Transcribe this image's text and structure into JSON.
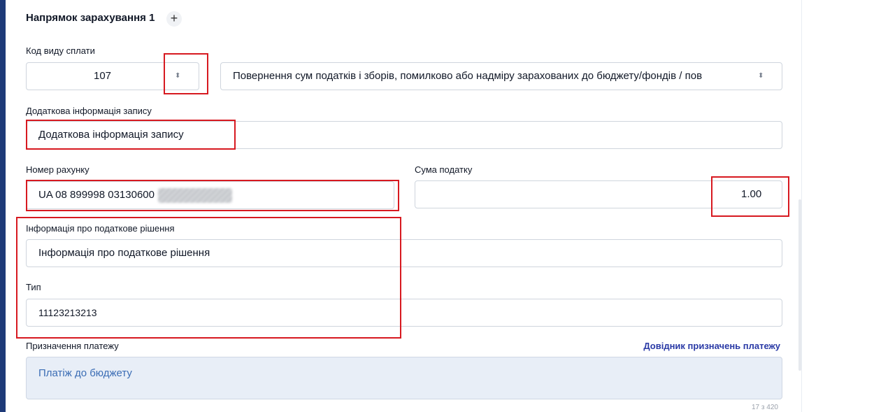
{
  "section": {
    "title": "Напрямок зарахування 1",
    "add_label": "+"
  },
  "payment_code": {
    "label": "Код виду сплати",
    "code_value": "107",
    "description_value": "Повернення сум податків і зборів, помилково або надміру зарахованих до бюджету/фондів / пов"
  },
  "additional_info": {
    "label": "Додаткова інформація запису",
    "value": "Додаткова інформація запису"
  },
  "account": {
    "label": "Номер рахунку",
    "value": "UA 08 899998 03130600"
  },
  "tax_amount": {
    "label": "Сума податку",
    "value": "1.00"
  },
  "tax_decision": {
    "label": "Інформація про податкове рішення",
    "value": "Інформація про податкове рішення"
  },
  "type": {
    "label": "Тип",
    "value": "11123213213"
  },
  "purpose": {
    "label": "Призначення платежу",
    "directory_link": "Довідник призначень платежу",
    "value": "Платіж до бюджету",
    "counter": "17 з 420"
  },
  "icons": {
    "sort": "sort-arrows-icon",
    "add": "plus-icon"
  },
  "colors": {
    "highlight": "#d71920",
    "link": "#2a3aa6",
    "textarea_bg": "#e8eef7"
  }
}
